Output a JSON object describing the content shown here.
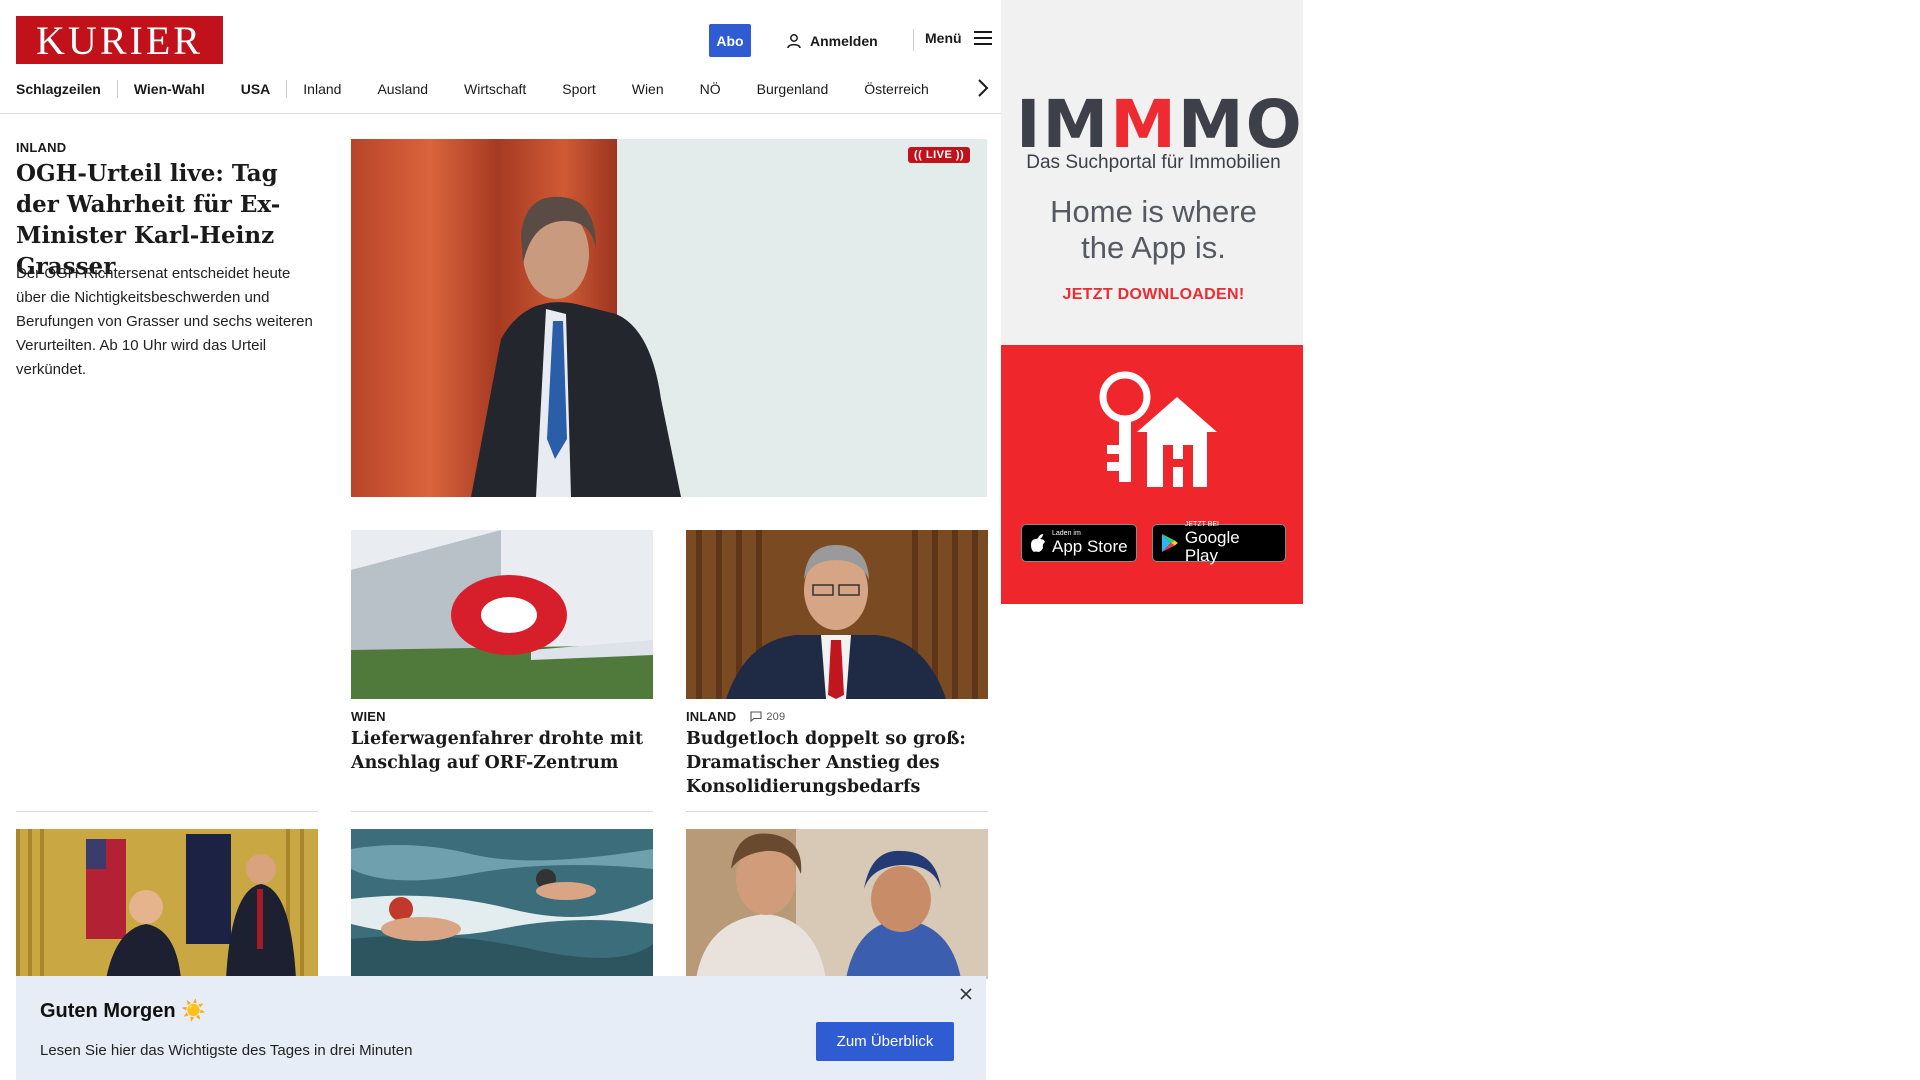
{
  "header": {
    "logo_text": "KURIER",
    "abo_label": "Abo",
    "login_label": "Anmelden",
    "menu_label": "Menü"
  },
  "nav": {
    "items": [
      "Schlagzeilen",
      "Wien-Wahl",
      "USA",
      "Inland",
      "Ausland",
      "Wirtschaft",
      "Sport",
      "Wien",
      "NÖ",
      "Burgenland",
      "Österreich"
    ]
  },
  "lead": {
    "kicker": "INLAND",
    "title": "OGH-Urteil live: Tag der Wahrheit für Ex-Minister Karl-Heinz Grasser",
    "text": "Der OGH-Richtersenat entscheidet heute über die Nichtigkeitsbeschwerden und Berufungen von Grasser und sechs weiteren Verurteilten. Ab 10 Uhr wird das Urteil verkündet.",
    "live_badge": "(( LIVE ))"
  },
  "cards": [
    {
      "kicker": "WIEN",
      "title": "Lieferwagenfahrer drohte mit Anschlag auf ORF-Zentrum"
    },
    {
      "kicker": "INLAND",
      "comments": "209",
      "title": "Budgetloch doppelt so groß: Dramatischer Anstieg des Konsolidierungsbedarfs"
    }
  ],
  "ad": {
    "logo_part1": "IM",
    "logo_part2": "M",
    "logo_part3": "MO",
    "subtitle": "Das Suchportal für Immobilien",
    "slogan_line1": "Home is where",
    "slogan_line2": "the App is.",
    "cta": "JETZT DOWNLOADEN!",
    "appstore_small": "Laden im",
    "appstore_big": "App Store",
    "googleplay_small": "JETZT BEI",
    "googleplay_big": "Google Play"
  },
  "banner": {
    "title": "Guten Morgen ☀️",
    "text": "Lesen Sie hier das Wichtigste des Tages in drei Minuten",
    "button": "Zum Überblick"
  },
  "colors": {
    "brand_red": "#c1121b",
    "accent_blue": "#2f5bd3",
    "ad_red": "#f0262d",
    "banner_bg": "#e6edf7"
  }
}
